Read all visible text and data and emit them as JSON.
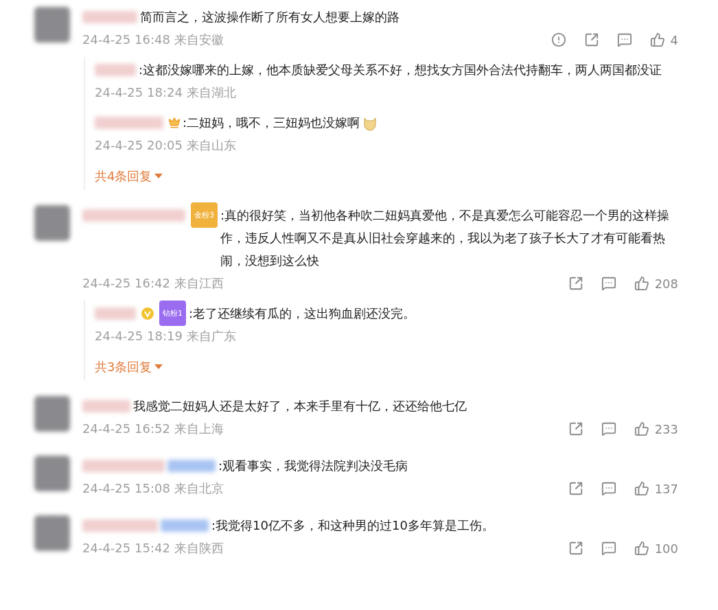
{
  "comments": [
    {
      "text": "简而言之，这波操作断了所有女人想要上嫁的路",
      "time": "24-4-25 16:48 来自安徽",
      "actions": [
        {
          "kind": "report"
        },
        {
          "kind": "share"
        },
        {
          "kind": "comment"
        },
        {
          "kind": "like",
          "count": "4"
        }
      ],
      "replies": [
        {
          "text": ":这都没嫁哪来的上嫁，他本质缺爱父母关系不好，想找女方国外合法代持翻车，两人两国都没证",
          "emoji": false,
          "time": "24-4-25 18:24 来自湖北"
        },
        {
          "badges": [
            {
              "kind": "crown"
            }
          ],
          "text": ":二妞妈，哦不，三妞妈也没嫁啊",
          "emoji": true,
          "time": "24-4-25 20:05 来自山东"
        }
      ],
      "more_replies": "共4条回复"
    },
    {
      "badges": [
        {
          "kind": "fan",
          "label": "金粉3",
          "color": "#f0b23c"
        }
      ],
      "text": ":真的很好笑，当初他各种吹二妞妈真爱他，不是真爱怎么可能容忍一个男的这样操作，违反人性啊又不是真从旧社会穿越来的，我以为老了孩子长大了才有可能看热闹，没想到这么快",
      "time": "24-4-25 16:42 来自江西",
      "actions": [
        {
          "kind": "share"
        },
        {
          "kind": "comment"
        },
        {
          "kind": "like",
          "count": "208"
        }
      ],
      "replies": [
        {
          "badges": [
            {
              "kind": "verified"
            },
            {
              "kind": "fan",
              "label": "钻粉1",
              "color": "#9a6cf0"
            }
          ],
          "text": ":老了还继续有瓜的，这出狗血剧还没完。",
          "emoji": false,
          "time": "24-4-25 18:19 来自广东"
        }
      ],
      "more_replies": "共3条回复"
    },
    {
      "text": "我感觉二妞妈人还是太好了，本来手里有十亿，还还给他七亿",
      "time": "24-4-25 16:52 来自上海",
      "actions": [
        {
          "kind": "share"
        },
        {
          "kind": "comment"
        },
        {
          "kind": "like",
          "count": "233"
        }
      ]
    },
    {
      "badges": [
        {
          "kind": "blurred"
        }
      ],
      "text": ":观看事实，我觉得法院判决没毛病",
      "time": "24-4-25 15:08 来自北京",
      "actions": [
        {
          "kind": "share"
        },
        {
          "kind": "comment"
        },
        {
          "kind": "like",
          "count": "137"
        }
      ]
    },
    {
      "badges": [
        {
          "kind": "blurred"
        }
      ],
      "text": ":我觉得10亿不多，和这种男的过10多年算是工伤。",
      "time": "24-4-25 15:42 来自陕西",
      "actions": [
        {
          "kind": "share"
        },
        {
          "kind": "comment"
        },
        {
          "kind": "like",
          "count": "100"
        }
      ]
    }
  ]
}
